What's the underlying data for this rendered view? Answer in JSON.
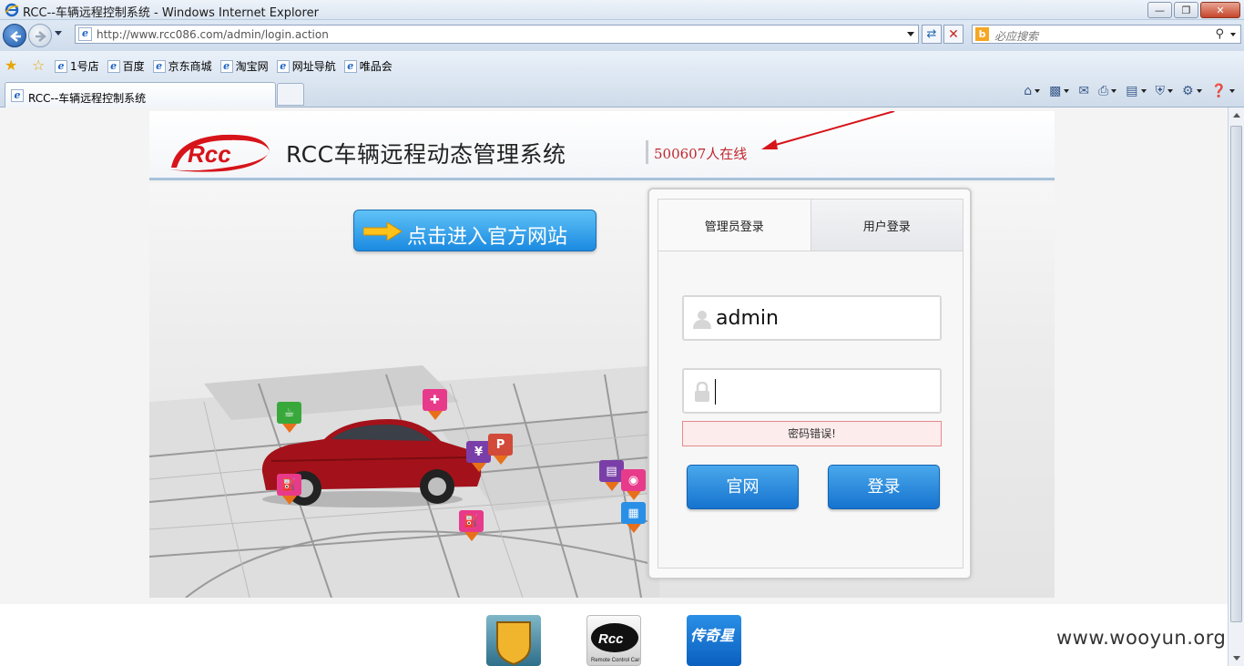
{
  "window": {
    "title": "RCC--车辆远程控制系统 - Windows Internet Explorer"
  },
  "address_bar": {
    "url": "http://www.rcc086.com/admin/login.action"
  },
  "search": {
    "placeholder": "必应搜索"
  },
  "favorites": [
    {
      "label": "1号店"
    },
    {
      "label": "百度"
    },
    {
      "label": "京东商城"
    },
    {
      "label": "淘宝网"
    },
    {
      "label": "网址导航"
    },
    {
      "label": "唯品会"
    }
  ],
  "tab": {
    "title": "RCC--车辆远程控制系统"
  },
  "page": {
    "system_title": "RCC车辆远程动态管理系统",
    "online_count": "500607人在线",
    "official_button": "点击进入官方网站",
    "logo_text": "Rcc"
  },
  "login": {
    "tab_admin": "管理员登录",
    "tab_user": "用户登录",
    "username_value": "admin",
    "password_value": "",
    "error_message": "密码错误!",
    "site_button": "官网",
    "login_button": "登录"
  },
  "footer": {
    "logo2_text": "Rcc",
    "logo2_subtext": "Remote Control Car",
    "logo3_text": "传奇星"
  },
  "watermark": "www.wooyun.org",
  "colors": {
    "accent_blue": "#1b8ae0",
    "online_red": "#c1272d",
    "error_bg": "#fdecec"
  }
}
